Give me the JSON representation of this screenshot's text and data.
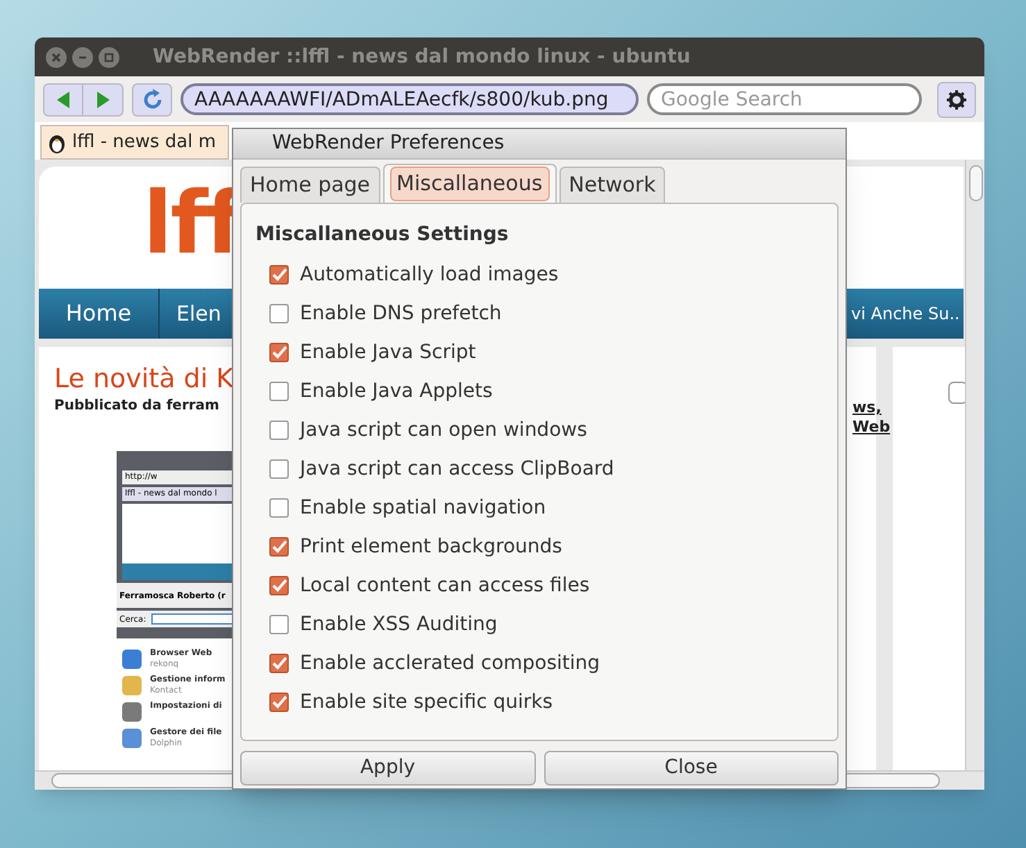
{
  "window": {
    "title": "WebRender ::lffl - news dal mondo linux - ubuntu"
  },
  "toolbar": {
    "url": "AAAAAAAWFI/ADmALEAecfk/s800/kub.png",
    "search_placeholder": "Google Search"
  },
  "browser_tab": {
    "label": "lffl - news dal m"
  },
  "page": {
    "logo": "lff",
    "nav": [
      "Home",
      "Elen"
    ],
    "nav_right": "vi Anche Su..",
    "post_title": "Le novità di K",
    "byline": "Pubblicato da ferram",
    "sidebar_checkbox": {
      "checked": false
    },
    "tags": [
      "ws,",
      "Web"
    ],
    "embedded": {
      "url": "http://w",
      "tab": "lffl - news dal mondo l",
      "user": "Ferramosca Roberto (r",
      "search_label": "Cerca:",
      "apps": [
        {
          "name": "Browser Web",
          "sub": "rekonq"
        },
        {
          "name": "Gestione inform",
          "sub": "Kontact"
        },
        {
          "name": "Impostazioni di"
        },
        {
          "name": "Gestore dei file",
          "sub": "Dolphin"
        }
      ]
    }
  },
  "dialog": {
    "title": "WebRender Preferences",
    "tabs": [
      {
        "label": "Home page",
        "selected": false
      },
      {
        "label": "Miscallaneous",
        "selected": true
      },
      {
        "label": "Network",
        "selected": false
      }
    ],
    "section": "Miscallaneous Settings",
    "options": [
      {
        "label": "Automatically load images",
        "checked": true
      },
      {
        "label": "Enable DNS prefetch",
        "checked": false
      },
      {
        "label": "Enable Java Script",
        "checked": true
      },
      {
        "label": "Enable Java Applets",
        "checked": false
      },
      {
        "label": "Java script can open windows",
        "checked": false
      },
      {
        "label": "Java script can access ClipBoard",
        "checked": false
      },
      {
        "label": "Enable spatial navigation",
        "checked": false
      },
      {
        "label": "Print element backgrounds",
        "checked": true
      },
      {
        "label": "Local content can access files",
        "checked": true
      },
      {
        "label": "Enable XSS Auditing",
        "checked": false
      },
      {
        "label": "Enable acclerated compositing",
        "checked": true
      },
      {
        "label": "Enable site specific quirks",
        "checked": true
      }
    ],
    "buttons": [
      "Apply",
      "Close"
    ]
  }
}
